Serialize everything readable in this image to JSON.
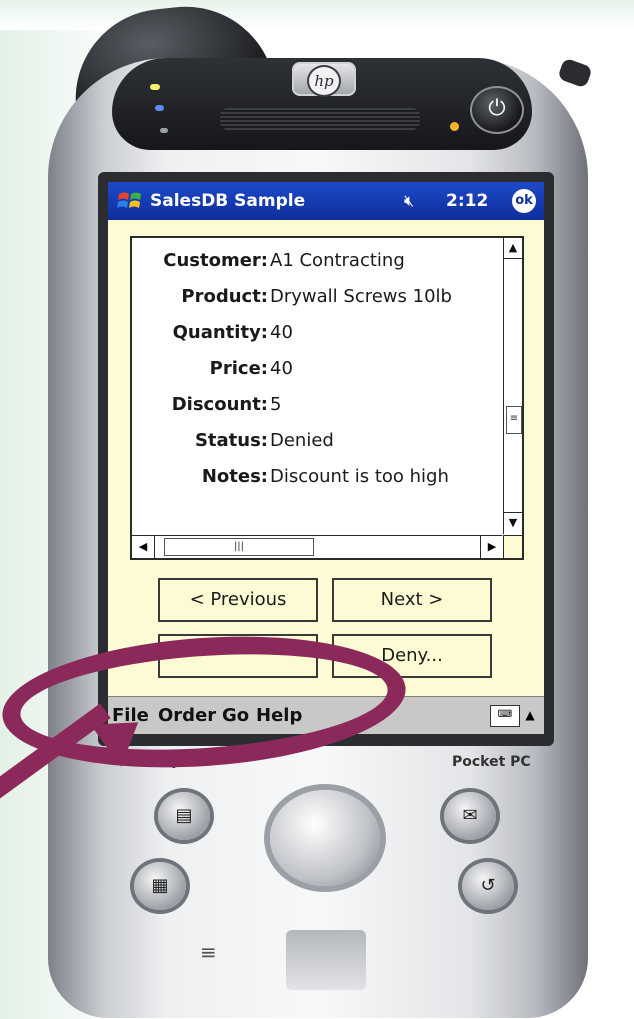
{
  "device": {
    "brand_logo": "hp",
    "brand_text": "iPAQ",
    "platform_text": "Pocket PC"
  },
  "titlebar": {
    "app_title": "SalesDB Sample",
    "time": "2:12",
    "speaker_icon": "speaker-muted-icon",
    "ok_label": "ok",
    "color": "#1d49c9"
  },
  "record": {
    "fields": [
      {
        "label": "Customer:",
        "value": "A1 Contracting"
      },
      {
        "label": "Product:",
        "value": "Drywall Screws 10lb"
      },
      {
        "label": "Quantity:",
        "value": "40"
      },
      {
        "label": "Price:",
        "value": "40"
      },
      {
        "label": "Discount:",
        "value": "5"
      },
      {
        "label": "Status:",
        "value": "Denied"
      },
      {
        "label": "Notes:",
        "value": "Discount is too high"
      }
    ]
  },
  "buttons": {
    "previous": "< Previous",
    "next": "Next >",
    "deny": "Deny..."
  },
  "menubar": {
    "items": [
      "File",
      "Order",
      "Go",
      "Help"
    ]
  },
  "colors": {
    "screen_bg": "#fdfbd3",
    "annotation": "#8b2a5a"
  }
}
